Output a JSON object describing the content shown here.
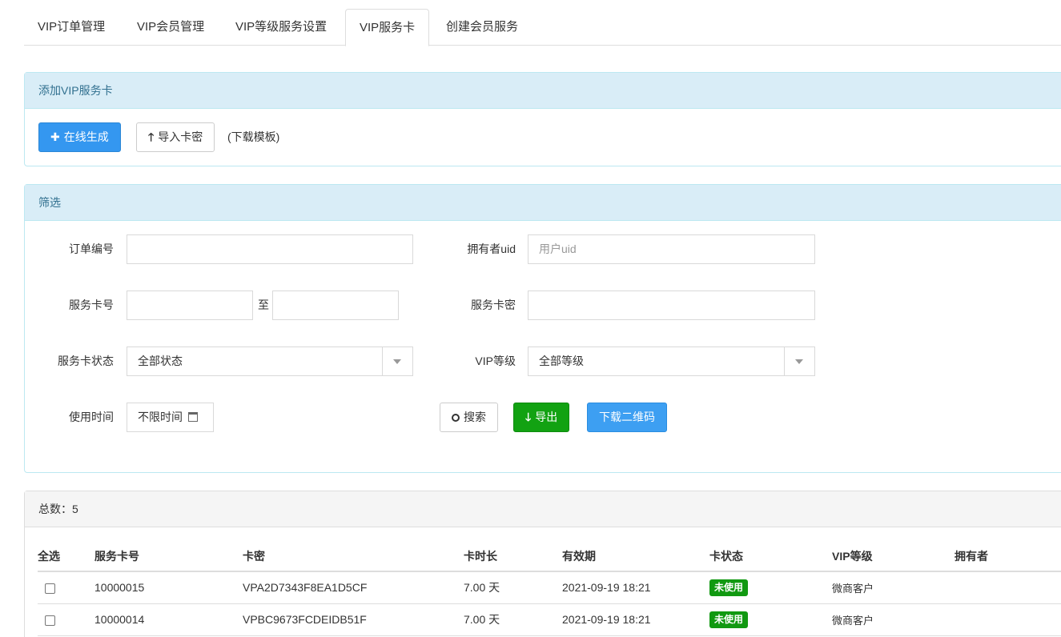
{
  "tabs": [
    "VIP订单管理",
    "VIP会员管理",
    "VIP等级服务设置",
    "VIP服务卡",
    "创建会员服务"
  ],
  "active_tab": "VIP服务卡",
  "add_panel": {
    "title": "添加VIP服务卡",
    "generate_label": "在线生成",
    "generate_icon": "plus-icon",
    "import_label": "导入卡密",
    "import_icon": "arrow-up-icon",
    "template_label": "(下载模板)"
  },
  "filter_panel": {
    "title": "筛选",
    "order_no_label": "订单编号",
    "order_no_value": "",
    "owner_uid_label": "拥有者uid",
    "owner_uid_placeholder": "用户uid",
    "card_no_label": "服务卡号",
    "range_to": "至",
    "card_secret_label": "服务卡密",
    "card_status_label": "服务卡状态",
    "card_status_value": "全部状态",
    "vip_level_label": "VIP等级",
    "vip_level_value": "全部等级",
    "use_time_label": "使用时间",
    "use_time_value": "不限时间",
    "search_label": "搜索",
    "export_label": "导出",
    "qrcode_label": "下载二维码"
  },
  "results": {
    "total_label": "总数：5",
    "columns": [
      "全选",
      "服务卡号",
      "卡密",
      "卡时长",
      "有效期",
      "卡状态",
      "VIP等级",
      "拥有者"
    ],
    "rows": [
      {
        "card_no": "10000015",
        "secret": "VPA2D7343F8EA1D5CF",
        "duration": "7.00 天",
        "expiry": "2021-09-19 18:21",
        "status": "未使用",
        "level": "微商客户",
        "owner": ""
      },
      {
        "card_no": "10000014",
        "secret": "VPBC9673FCDEIDB51F",
        "duration": "7.00 天",
        "expiry": "2021-09-19 18:21",
        "status": "未使用",
        "level": "微商客户",
        "owner": ""
      }
    ]
  },
  "colors": {
    "heading_bg": "#d9edf7",
    "primary": "#3497f0",
    "success": "#12a212",
    "badge": "#119911"
  }
}
